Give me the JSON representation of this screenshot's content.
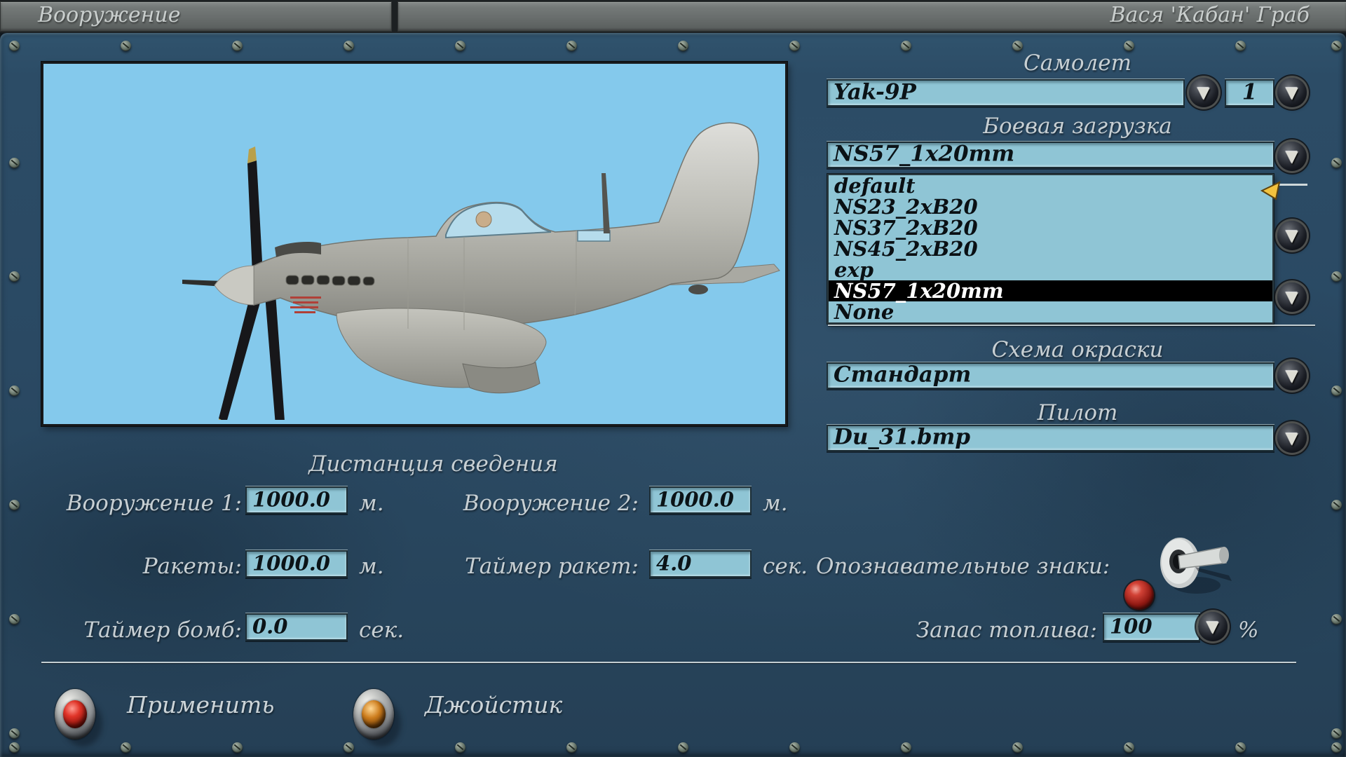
{
  "header": {
    "left_title": "Вооружение",
    "right_title": "Вася 'Кабан' Граб"
  },
  "aircraft_section": {
    "label": "Самолет",
    "value": "Yak-9P",
    "count": "1"
  },
  "loadout_section": {
    "label": "Боевая загрузка",
    "value": "NS57_1x20mm",
    "options": [
      "default",
      "NS23_2xB20",
      "NS37_2xB20",
      "NS45_2xB20",
      "exp",
      "NS57_1x20mm",
      "None"
    ],
    "selected_option": "NS57_1x20mm"
  },
  "paint_section": {
    "label": "Схема окраски",
    "value": "Стандарт"
  },
  "pilot_section": {
    "label": "Пилот",
    "value": "Du_31.bmp"
  },
  "convergence": {
    "heading": "Дистанция сведения",
    "fields": [
      {
        "label": "Вооружение 1:",
        "value": "1000.0",
        "unit": "м."
      },
      {
        "label": "Вооружение 2:",
        "value": "1000.0",
        "unit": "м."
      },
      {
        "label": "Ракеты:",
        "value": "1000.0",
        "unit": "м."
      },
      {
        "label": "Таймер ракет:",
        "value": "4.0",
        "unit": "сек."
      },
      {
        "label": "Таймер бомб:",
        "value": "0.0",
        "unit": "сек."
      }
    ]
  },
  "markings": {
    "label": "Опознавательные знаки:",
    "lamp_color": "#b02a20",
    "lever_direction": "right"
  },
  "fuel": {
    "label": "Запас топлива:",
    "value": "100",
    "unit": "%"
  },
  "buttons": {
    "apply": "Применить",
    "joystick": "Джойстик"
  },
  "icons": {
    "dropdown_arrow": "▼"
  },
  "colors": {
    "panel_blue": "#2a4963",
    "titlebar_gray": "#686d6c",
    "field_bg": "#8fc5d5",
    "preview_bg": "#84c9ec",
    "selected_row_bg": "#000000",
    "selected_row_text": "#ffffff",
    "label_text": "#c7cfd3",
    "cursor_yellow": "#f2c23e"
  }
}
